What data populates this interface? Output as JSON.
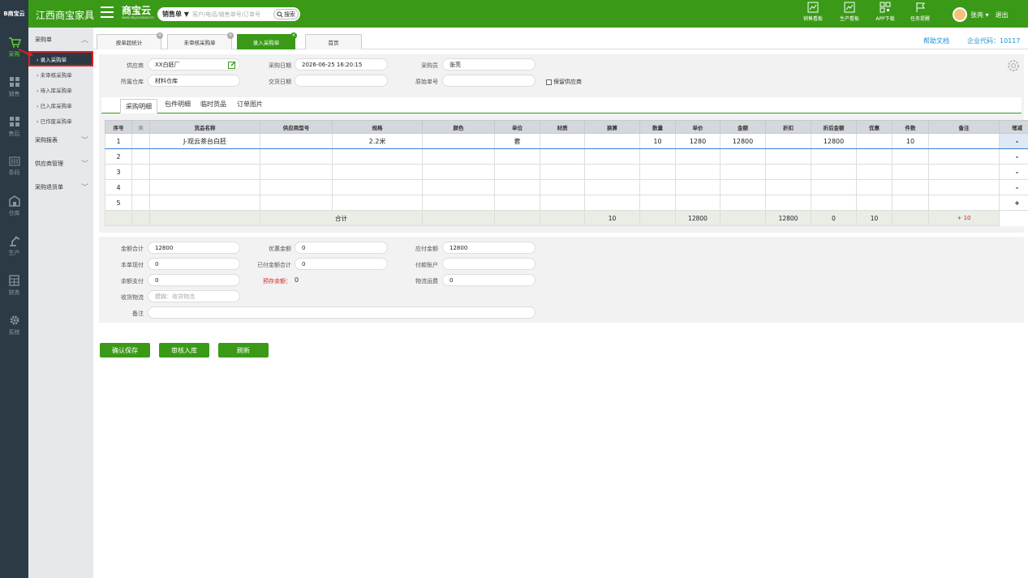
{
  "topbar": {
    "logo": "B商宝云",
    "company": "江西商宝家具",
    "brand": "商宝云",
    "brand_sub": "www.sbyuncloud.cn",
    "search_type": "销售单 ▼",
    "search_placeholder": "客户/电话/销售单号/订单号",
    "search_btn": "搜索",
    "items": [
      "销售看板",
      "生产看板",
      "APP下载",
      "任务提醒"
    ],
    "user": "张亮 ▾",
    "logout": "退出"
  },
  "leftnav": [
    "采购",
    "销售",
    "售后",
    "条码",
    "仓库",
    "生产",
    "财务",
    "系统"
  ],
  "submenu": {
    "head1": "采购单",
    "subs": [
      "› 录入采购单",
      "› 未审核采购单",
      "› 待入库采购单",
      "› 已入库采购单",
      "› 已作废采购单"
    ],
    "others": [
      "采购报表",
      "供应商管理",
      "采购退货单"
    ]
  },
  "tabs": [
    "按单超统计",
    "未审核采购单",
    "录入采购单",
    "首页"
  ],
  "links": {
    "help": "帮助文档",
    "company_code": "企业代码：10117"
  },
  "form": {
    "supplier_l": "供应商",
    "supplier": "XX白胚厂",
    "date_l": "采购日期",
    "date": "2026-06-25 16:20:15",
    "buyer_l": "采购员",
    "buyer": "张亮",
    "wh_l": "所属仓库",
    "wh": "材料仓库",
    "deliv_l": "交货日期",
    "orig_l": "原始单号",
    "keep": "保留供应商"
  },
  "inner_tabs": [
    "采购明细",
    "包件明细",
    "临时货品",
    "订单图片"
  ],
  "grid": {
    "headers": [
      "序号",
      "类",
      "货品名称",
      "供应商型号",
      "规格",
      "颜色",
      "单位",
      "材质",
      "换算",
      "数量",
      "单价",
      "金额",
      "折扣",
      "折后金额",
      "优惠",
      "件数",
      "备注",
      "增减"
    ],
    "rows": [
      [
        "1",
        "",
        "J-观云茶台白胚",
        "",
        "2.2米",
        "",
        "套",
        "",
        "",
        "10",
        "1280",
        "12800",
        "",
        "12800",
        "",
        "10",
        ""
      ],
      [
        "2"
      ],
      [
        "3"
      ],
      [
        "4"
      ],
      [
        "5"
      ]
    ],
    "sum": {
      "label": "合计",
      "qty": "10",
      "amount": "12800",
      "after": "12800",
      "disc": "0",
      "pieces": "10",
      "delta": "+ 10"
    }
  },
  "summary": {
    "total_l": "金额合计",
    "total": "12800",
    "disc_l": "优惠金额",
    "disc": "0",
    "payable_l": "应付金额",
    "payable": "12800",
    "cash_l": "本单现付",
    "cash": "0",
    "paid_l": "已付金额合计",
    "paid": "0",
    "acct_l": "付款账户",
    "bal_l": "余额支付",
    "bal": "0",
    "prestore_l": "预存余额：",
    "prestore": "0",
    "freight_l": "物流运费",
    "freight": "0",
    "logi_l": "收货物流",
    "logi_ph": "模糊：收货物流",
    "note_l": "备注"
  },
  "buttons": [
    "确认保存",
    "审核入库",
    "刷新"
  ]
}
